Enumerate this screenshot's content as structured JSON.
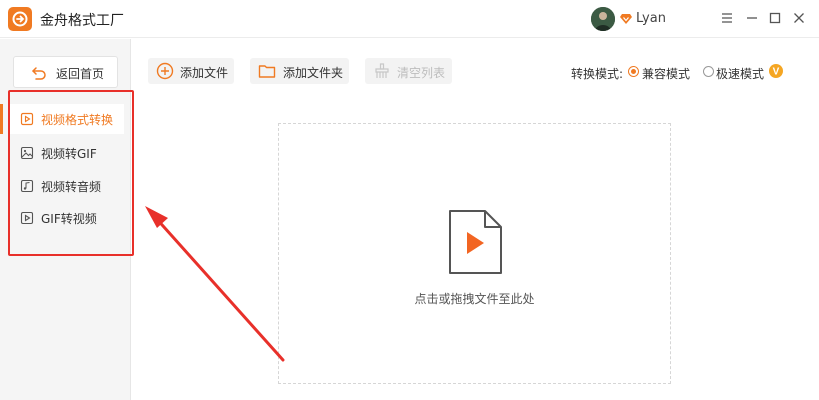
{
  "app": {
    "title": "金舟格式工厂"
  },
  "user": {
    "name": "Lyan"
  },
  "sidebar": {
    "back_label": "返回首页",
    "items": [
      {
        "label": "视频格式转换",
        "icon": "video-play-icon",
        "active": true
      },
      {
        "label": "视频转GIF",
        "icon": "image-icon",
        "active": false
      },
      {
        "label": "视频转音频",
        "icon": "music-note-icon",
        "active": false
      },
      {
        "label": "GIF转视频",
        "icon": "video-play-icon",
        "active": false
      }
    ]
  },
  "toolbar": {
    "add_file": "添加文件",
    "add_folder": "添加文件夹",
    "clear_list": "清空列表",
    "mode_label": "转换模式:",
    "modes": [
      {
        "label": "兼容模式",
        "selected": true
      },
      {
        "label": "极速模式",
        "selected": false
      }
    ],
    "vip_badge": "V"
  },
  "dropzone": {
    "text": "点击或拖拽文件至此处"
  },
  "colors": {
    "accent": "#f07a22",
    "annotation": "#e8302a"
  }
}
